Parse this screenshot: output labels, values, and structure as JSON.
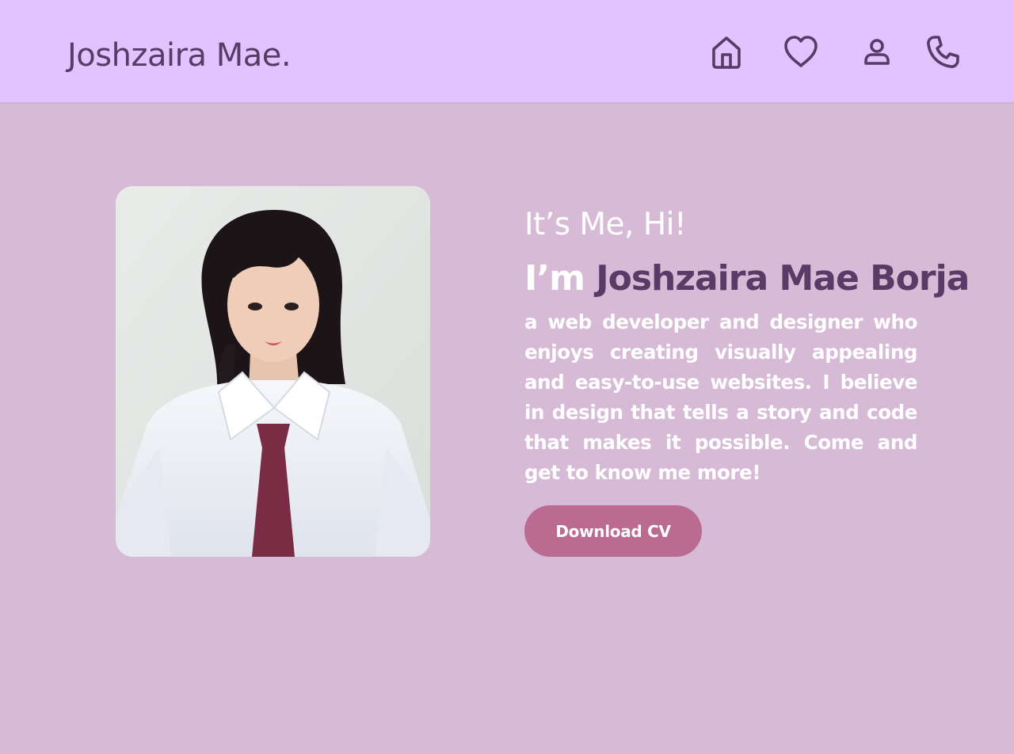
{
  "header": {
    "logo": "Joshzaira Mae.",
    "nav": [
      {
        "icon": "home-icon"
      },
      {
        "icon": "heart-icon"
      },
      {
        "icon": "user-icon"
      },
      {
        "icon": "phone-icon"
      }
    ]
  },
  "hero": {
    "greeting": "It’s Me, Hi!",
    "name_prefix": "I’m ",
    "name": "Joshzaira Mae Borja",
    "bio": "a web developer and designer who enjoys creating visually appealing and easy-to-use websites. I believe in design that tells a story and code that makes it possible. Come and get to know me more!",
    "cv_button": "Download CV"
  },
  "colors": {
    "header_bg": "#e0c3ff",
    "page_bg": "#d6bad6",
    "accent": "#5a3a66",
    "button_bg": "#bb6b91"
  }
}
